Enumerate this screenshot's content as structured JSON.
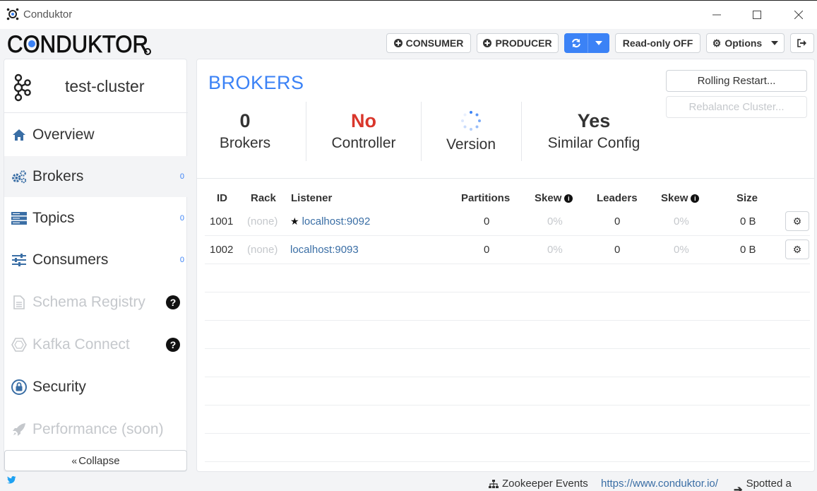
{
  "window": {
    "title": "Conduktor"
  },
  "brand": {
    "logo_text": "CONDUKTOR"
  },
  "toolbar": {
    "consumer_label": "CONSUMER",
    "producer_label": "PRODUCER",
    "readonly_label": "Read-only OFF",
    "options_label": "Options"
  },
  "sidebar": {
    "cluster_name": "test-cluster",
    "items": [
      {
        "label": "Overview",
        "count": ""
      },
      {
        "label": "Brokers",
        "count": "0"
      },
      {
        "label": "Topics",
        "count": "0"
      },
      {
        "label": "Consumers",
        "count": "0"
      },
      {
        "label": "Schema Registry",
        "count": ""
      },
      {
        "label": "Kafka Connect",
        "count": ""
      },
      {
        "label": "Security",
        "count": ""
      },
      {
        "label": "Performance (soon)",
        "count": ""
      }
    ],
    "help_glyph": "?",
    "collapse_label": "Collapse"
  },
  "main": {
    "title": "BROKERS",
    "stats": [
      {
        "value": "0",
        "label": "Brokers"
      },
      {
        "value": "No",
        "label": "Controller"
      },
      {
        "value": "",
        "label": "Version"
      },
      {
        "value": "Yes",
        "label": "Similar Config"
      }
    ],
    "actions": {
      "rolling_restart": "Rolling Restart...",
      "rebalance": "Rebalance Cluster..."
    },
    "table": {
      "headers": {
        "id": "ID",
        "rack": "Rack",
        "listener": "Listener",
        "partitions": "Partitions",
        "skew1": "Skew",
        "leaders": "Leaders",
        "skew2": "Skew",
        "size": "Size"
      },
      "rows": [
        {
          "id": "1001",
          "rack": "(none)",
          "listener": "localhost:9092",
          "is_controller": true,
          "partitions": "0",
          "skew1": "0%",
          "leaders": "0",
          "skew2": "0%",
          "size": "0 B"
        },
        {
          "id": "1002",
          "rack": "(none)",
          "listener": "localhost:9093",
          "is_controller": false,
          "partitions": "0",
          "skew1": "0%",
          "leaders": "0",
          "skew2": "0%",
          "size": "0 B"
        }
      ]
    }
  },
  "footer": {
    "zookeeper_label": "Zookeeper Events",
    "website": "https://www.conduktor.io/",
    "bug_label": "Spotted a bug?"
  },
  "colors": {
    "accent": "#3b82f6",
    "danger": "#d9362b",
    "link": "#3a6ea5",
    "muted": "#c5c8cc"
  },
  "icons": [
    "conduktor-app-icon",
    "minimize-icon",
    "maximize-icon",
    "close-icon",
    "plus-circle-icon",
    "refresh-icon",
    "caret-down-icon",
    "gear-icon",
    "logout-icon",
    "kafka-cluster-icon",
    "home-icon",
    "gears-icon",
    "server-icon",
    "sliders-icon",
    "file-icon",
    "hexagon-icon",
    "lock-icon",
    "rocket-icon",
    "chevrons-left-icon",
    "star-icon",
    "info-icon",
    "twitter-icon",
    "sitemap-icon",
    "arrow-right-icon"
  ]
}
